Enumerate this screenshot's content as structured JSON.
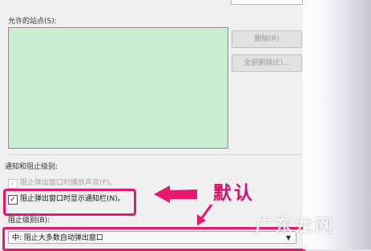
{
  "dialog": {
    "sites_label": "允许的站点(S):",
    "remove_button": "删除(R)",
    "remove_all_button": "全部删除(E)...",
    "section_label": "通知和阻止级别:",
    "sound_checkbox": {
      "label": "阻止弹出窗口时播放声音(P)。",
      "checked": true,
      "disabled": true
    },
    "notify_checkbox": {
      "label": "阻止弹出窗口时显示通知栏(N)。",
      "checked": true
    },
    "level_label": "阻止级别(B):",
    "level_value": "中: 阻止大多数自动弹出窗口"
  },
  "annotation": {
    "text": "默认",
    "color": "#d3126b"
  },
  "watermark": "广东龙网",
  "colors": {
    "highlight": "#e8186e",
    "list_bg": "#c9edd0"
  }
}
